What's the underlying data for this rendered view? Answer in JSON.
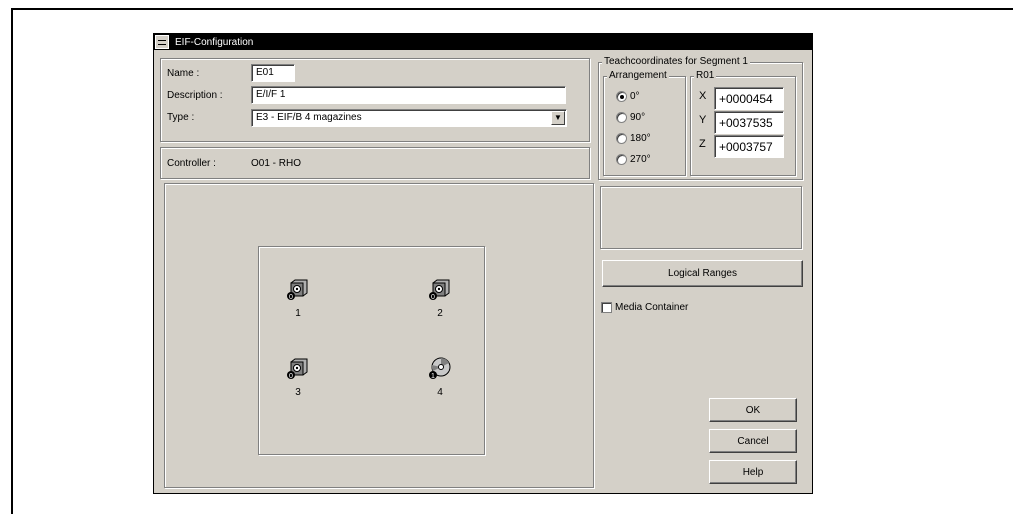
{
  "window": {
    "title": "EIF-Configuration"
  },
  "form": {
    "name_label": "Name :",
    "name_value": "E01",
    "description_label": "Description :",
    "description_value": "E/I/F 1",
    "type_label": "Type :",
    "type_value": "E3 - EIF/B 4 magazines",
    "controller_label": "Controller :",
    "controller_value": "O01 - RHO"
  },
  "teach": {
    "group_label": "Teachcoordinates for Segment 1",
    "arrangement_label": "Arrangement",
    "arrangement_options": [
      "0°",
      "90°",
      "180°",
      "270°"
    ],
    "arrangement_selected": "0°",
    "r_group_label": "R01",
    "x_label": "X",
    "x_value": "+0000454",
    "y_label": "Y",
    "y_value": "+0037535",
    "z_label": "Z",
    "z_value": "+0003757"
  },
  "magazines": [
    {
      "number": "1",
      "badge": "0",
      "icon": "magazine-box-icon"
    },
    {
      "number": "2",
      "badge": "0",
      "icon": "magazine-box-icon"
    },
    {
      "number": "3",
      "badge": "0",
      "icon": "magazine-box-icon"
    },
    {
      "number": "4",
      "badge": "1",
      "icon": "disc-icon"
    }
  ],
  "buttons": {
    "logical_ranges": "Logical Ranges",
    "ok": "OK",
    "cancel": "Cancel",
    "help": "Help"
  },
  "media_container_label": "Media Container"
}
